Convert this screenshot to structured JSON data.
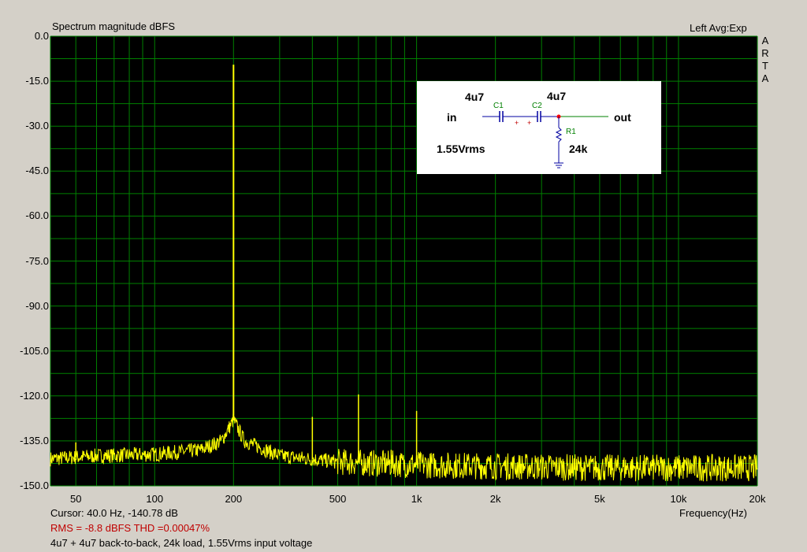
{
  "header": {
    "title": "Spectrum magnitude dBFS",
    "channel_info": "Left  Avg:Exp",
    "brand_letters": [
      "A",
      "R",
      "T",
      "A"
    ]
  },
  "footer": {
    "cursor": "Cursor:    40.0 Hz, -140.78 dB",
    "rms_thd": "RMS =   -8.8 dBFS   THD =0.00047%",
    "caption": "4u7 + 4u7 back-to-back, 24k load, 1.55Vrms input voltage"
  },
  "schematic": {
    "cap_value_1": "4u7",
    "cap_value_2": "4u7",
    "input_label": "in",
    "output_label": "out",
    "voltage_label": "1.55Vrms",
    "resistor_value": "24k",
    "c1_ref": "C1",
    "c2_ref": "C2",
    "r1_ref": "R1",
    "colors": {
      "wire": "#0000a0",
      "out_wire": "#008000",
      "node": "#ff0000"
    }
  },
  "chart_data": {
    "type": "line",
    "title": "Spectrum magnitude dBFS",
    "xlabel": "Frequency(Hz)",
    "ylabel": "",
    "x_scale": "log",
    "xlim": [
      40,
      20000
    ],
    "ylim": [
      -150,
      0
    ],
    "grid": true,
    "x_tick_labels": [
      "50",
      "100",
      "200",
      "500",
      "1k",
      "2k",
      "5k",
      "10k",
      "20k"
    ],
    "x_tick_values": [
      50,
      100,
      200,
      500,
      1000,
      2000,
      5000,
      10000,
      20000
    ],
    "y_tick_labels": [
      "0.0",
      "-15.0",
      "-30.0",
      "-45.0",
      "-60.0",
      "-75.0",
      "-90.0",
      "-105.0",
      "-120.0",
      "-135.0",
      "-150.0"
    ],
    "y_tick_values": [
      0,
      -15,
      -30,
      -45,
      -60,
      -75,
      -90,
      -105,
      -120,
      -135,
      -150
    ],
    "colors": {
      "background": "#000000",
      "grid": "#008000",
      "trace": "#ffff00",
      "frame": "#d4d0c8"
    },
    "series": [
      {
        "peaks": [
          {
            "x": 50,
            "y": -135.5
          },
          {
            "x": 200,
            "y": -9.5
          },
          {
            "x": 400,
            "y": -127
          },
          {
            "x": 600,
            "y": -119.5
          },
          {
            "x": 800,
            "y": -138
          },
          {
            "x": 1000,
            "y": -125
          }
        ],
        "noise_floor": [
          {
            "x": 40,
            "y": -141
          },
          {
            "x": 60,
            "y": -140
          },
          {
            "x": 100,
            "y": -139.5
          },
          {
            "x": 150,
            "y": -138
          },
          {
            "x": 180,
            "y": -135
          },
          {
            "x": 200,
            "y": -128
          },
          {
            "x": 220,
            "y": -135
          },
          {
            "x": 300,
            "y": -140
          },
          {
            "x": 500,
            "y": -142
          },
          {
            "x": 1000,
            "y": -143
          },
          {
            "x": 5000,
            "y": -144
          },
          {
            "x": 20000,
            "y": -144
          }
        ]
      }
    ]
  }
}
